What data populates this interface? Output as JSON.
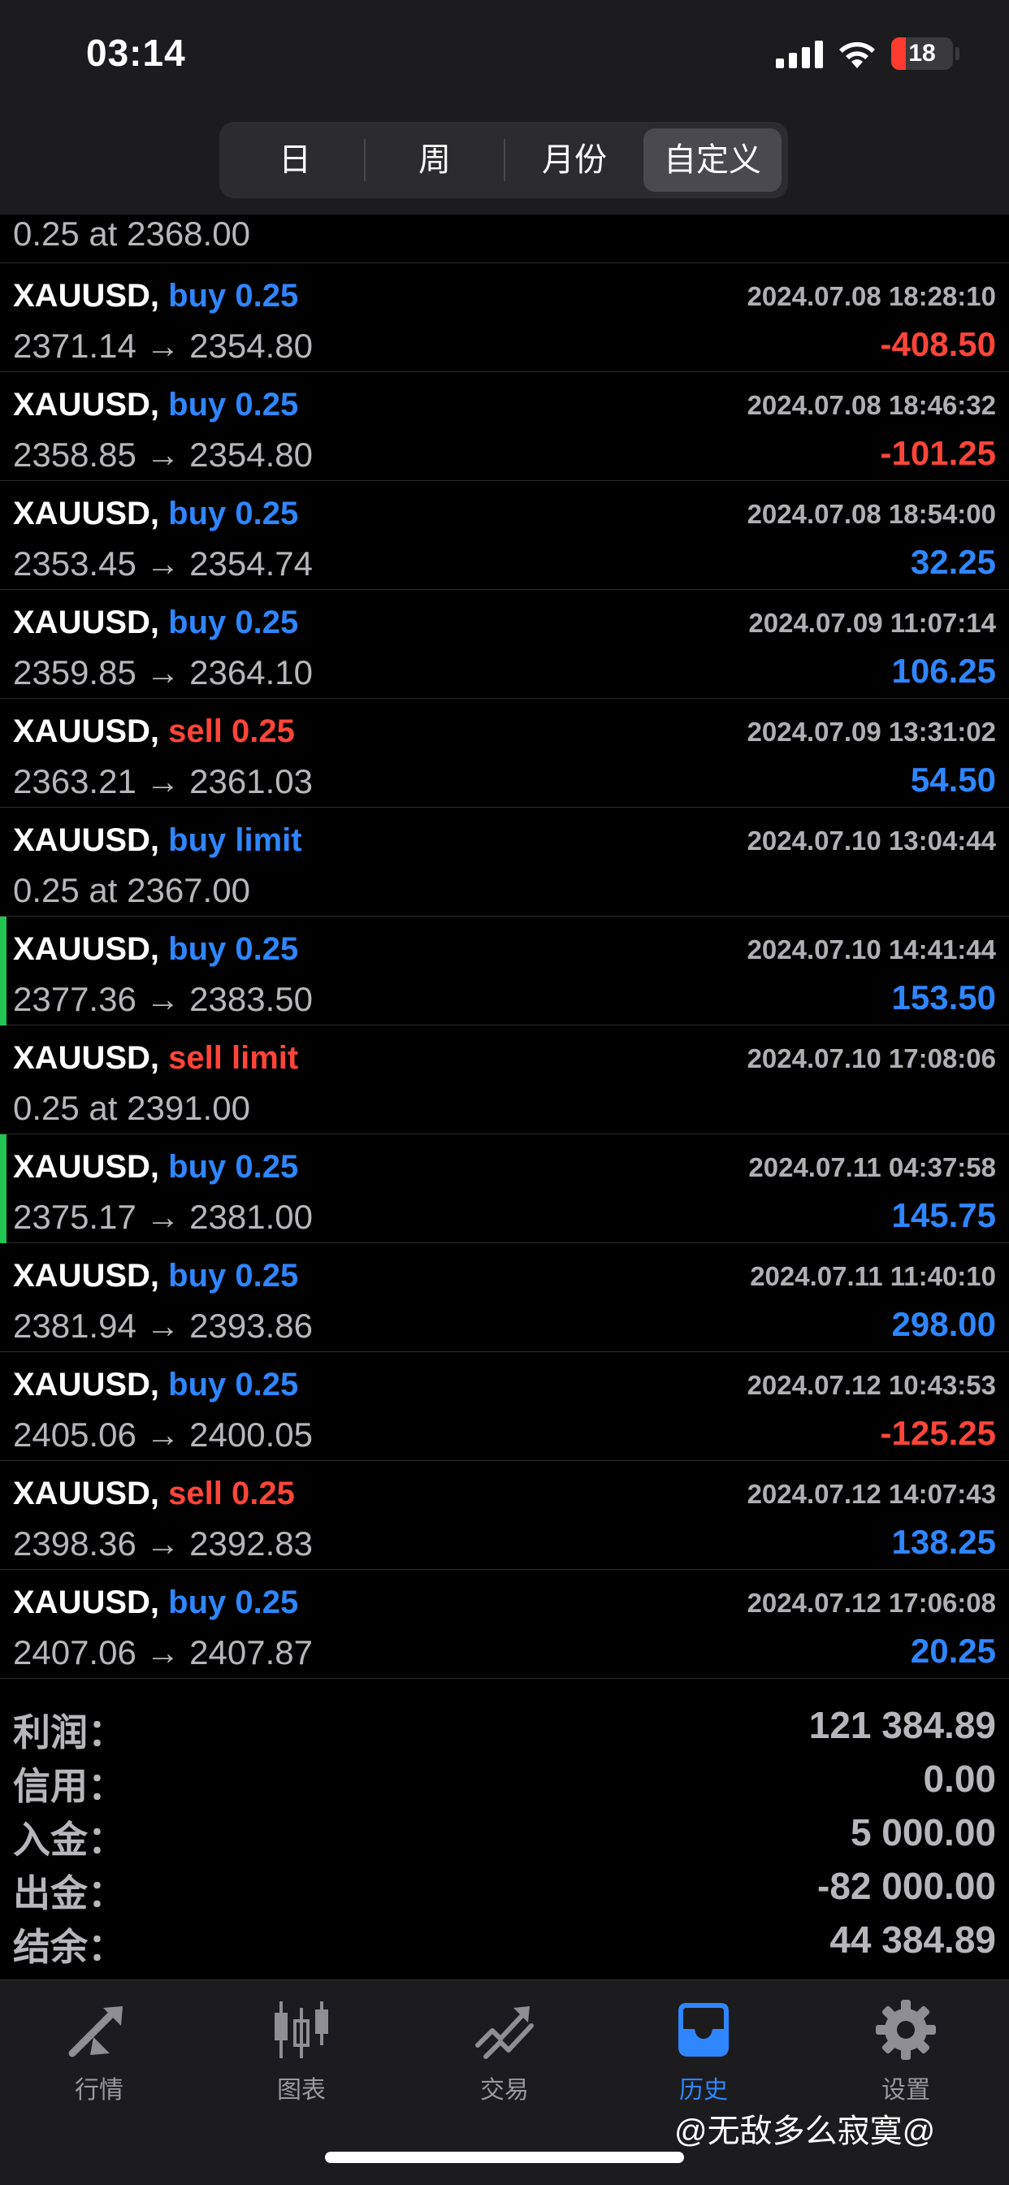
{
  "status": {
    "time": "03:14",
    "battery": "18"
  },
  "segments": [
    {
      "label": "日",
      "active": false
    },
    {
      "label": "周",
      "active": false
    },
    {
      "label": "月份",
      "active": false
    },
    {
      "label": "自定义",
      "active": true
    }
  ],
  "partial_row": {
    "prices": "0.25 at 2368.00"
  },
  "trades": [
    {
      "symbol": "XAUUSD,",
      "action": "buy 0.25",
      "side": "buy",
      "date": "2024.07.08 18:28:10",
      "prices": "2371.14 → 2354.80",
      "profit": "-408.50",
      "marker": false
    },
    {
      "symbol": "XAUUSD,",
      "action": "buy 0.25",
      "side": "buy",
      "date": "2024.07.08 18:46:32",
      "prices": "2358.85 → 2354.80",
      "profit": "-101.25",
      "marker": false
    },
    {
      "symbol": "XAUUSD,",
      "action": "buy 0.25",
      "side": "buy",
      "date": "2024.07.08 18:54:00",
      "prices": "2353.45 → 2354.74",
      "profit": "32.25",
      "marker": false
    },
    {
      "symbol": "XAUUSD,",
      "action": "buy 0.25",
      "side": "buy",
      "date": "2024.07.09 11:07:14",
      "prices": "2359.85 → 2364.10",
      "profit": "106.25",
      "marker": false
    },
    {
      "symbol": "XAUUSD,",
      "action": "sell 0.25",
      "side": "sell",
      "date": "2024.07.09 13:31:02",
      "prices": "2363.21 → 2361.03",
      "profit": "54.50",
      "marker": false
    },
    {
      "symbol": "XAUUSD,",
      "action": "buy limit",
      "side": "buy",
      "date": "2024.07.10 13:04:44",
      "prices": "0.25 at 2367.00",
      "profit": "",
      "marker": false
    },
    {
      "symbol": "XAUUSD,",
      "action": "buy 0.25",
      "side": "buy",
      "date": "2024.07.10 14:41:44",
      "prices": "2377.36 → 2383.50",
      "profit": "153.50",
      "marker": true
    },
    {
      "symbol": "XAUUSD,",
      "action": "sell limit",
      "side": "sell",
      "date": "2024.07.10 17:08:06",
      "prices": "0.25 at 2391.00",
      "profit": "",
      "marker": false
    },
    {
      "symbol": "XAUUSD,",
      "action": "buy 0.25",
      "side": "buy",
      "date": "2024.07.11 04:37:58",
      "prices": "2375.17 → 2381.00",
      "profit": "145.75",
      "marker": true
    },
    {
      "symbol": "XAUUSD,",
      "action": "buy 0.25",
      "side": "buy",
      "date": "2024.07.11 11:40:10",
      "prices": "2381.94 → 2393.86",
      "profit": "298.00",
      "marker": false
    },
    {
      "symbol": "XAUUSD,",
      "action": "buy 0.25",
      "side": "buy",
      "date": "2024.07.12 10:43:53",
      "prices": "2405.06 → 2400.05",
      "profit": "-125.25",
      "marker": false
    },
    {
      "symbol": "XAUUSD,",
      "action": "sell 0.25",
      "side": "sell",
      "date": "2024.07.12 14:07:43",
      "prices": "2398.36 → 2392.83",
      "profit": "138.25",
      "marker": false
    },
    {
      "symbol": "XAUUSD,",
      "action": "buy 0.25",
      "side": "buy",
      "date": "2024.07.12 17:06:08",
      "prices": "2407.06 → 2407.87",
      "profit": "20.25",
      "marker": false
    }
  ],
  "summary": [
    {
      "label": "利润：",
      "value": "121 384.89"
    },
    {
      "label": "信用：",
      "value": "0.00"
    },
    {
      "label": "入金：",
      "value": "5 000.00"
    },
    {
      "label": "出金：",
      "value": "-82 000.00"
    },
    {
      "label": "结余：",
      "value": "44 384.89"
    }
  ],
  "tabs": [
    {
      "label": "行情",
      "icon": "quotes-icon",
      "active": false
    },
    {
      "label": "图表",
      "icon": "chart-icon",
      "active": false
    },
    {
      "label": "交易",
      "icon": "trade-icon",
      "active": false
    },
    {
      "label": "历史",
      "icon": "history-icon",
      "active": true
    },
    {
      "label": "设置",
      "icon": "settings-icon",
      "active": false
    }
  ],
  "watermark": "@无敌多么寂寞@",
  "colors": {
    "buy": "#2f86ff",
    "sell": "#ff4539",
    "marker": "#23c552",
    "active_tab": "#2f86ff"
  }
}
